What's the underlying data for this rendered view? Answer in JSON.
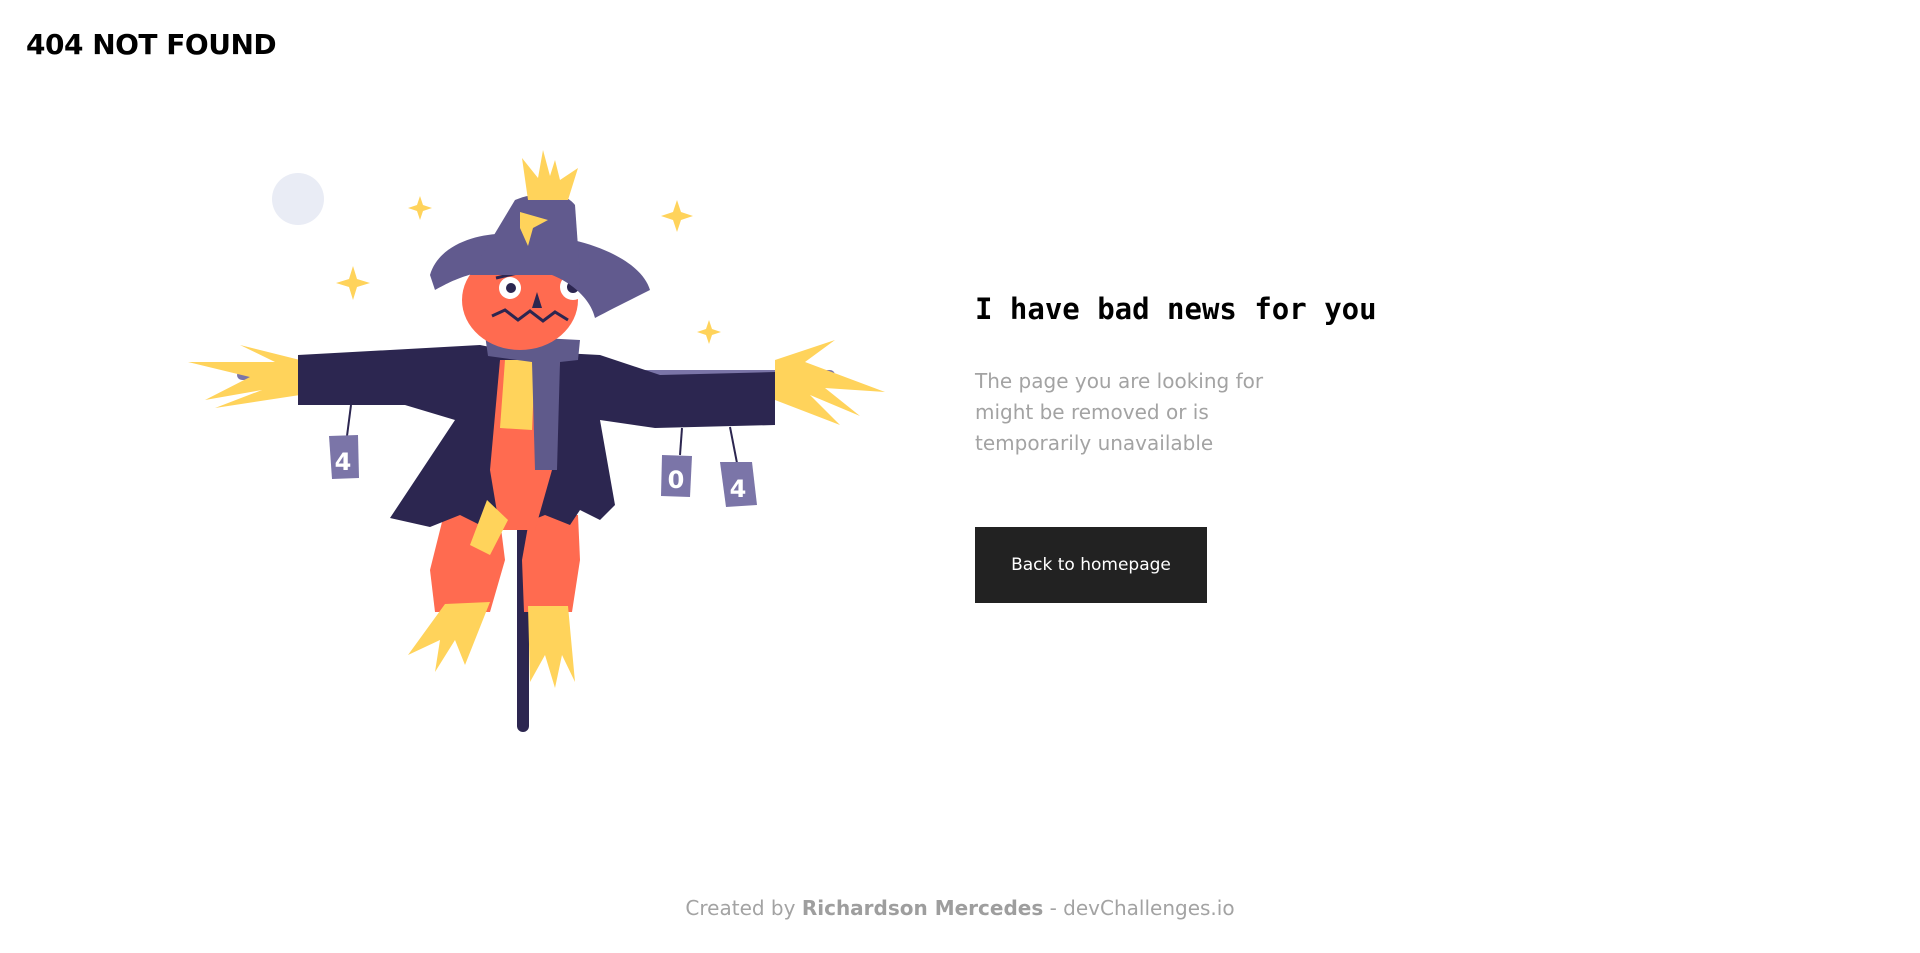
{
  "header": {
    "title": "404 NOT FOUND"
  },
  "illustration": {
    "name": "scarecrow",
    "can_labels": [
      "4",
      "0",
      "4"
    ],
    "colors": {
      "hat": "#615A8E",
      "coat": "#2C2650",
      "face": "#FF6B50",
      "straw": "#FFD35B",
      "scarf": "#5F5A8B",
      "moon": "#E9ECF5",
      "can": "#7B75A8"
    }
  },
  "main": {
    "headline": "I have bad news for you",
    "message": "The page you are looking for might be removed or is temporarily unavailable",
    "cta_label": "Back to homepage"
  },
  "footer": {
    "prefix": "Created by",
    "author": "Richardson Mercedes",
    "separator": "-",
    "site": "devChallenges.io"
  }
}
